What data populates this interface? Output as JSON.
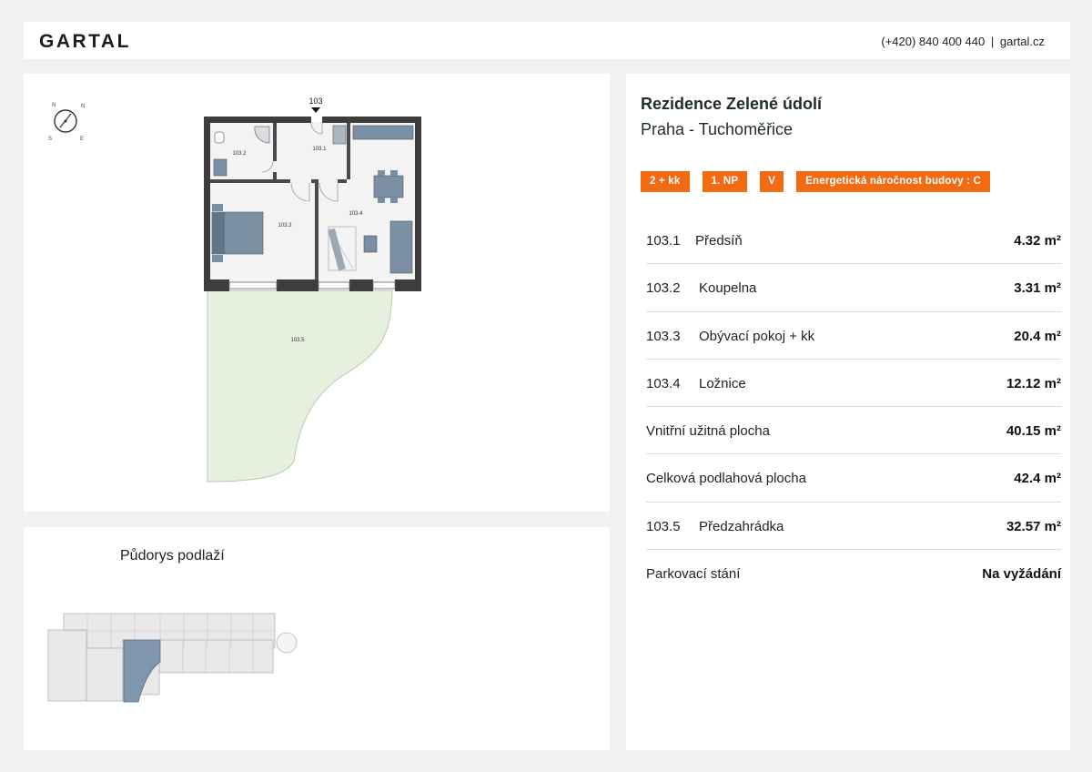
{
  "header": {
    "logo": "GARTAL",
    "phone": "(+420) 840 400 440",
    "separator": "|",
    "website": "gartal.cz"
  },
  "plan": {
    "unit_label": "103",
    "rooms": {
      "r1031": "103.1",
      "r1032": "103.2",
      "r1033": "103.3",
      "r1034": "103.4",
      "r1035": "103.5"
    },
    "compass_icon": "compass-icon"
  },
  "floor": {
    "title": "Půdorys podlaží"
  },
  "info": {
    "project_name": "Rezidence Zelené údolí",
    "location": "Praha - Tuchoměřice",
    "badges": [
      "2 + kk",
      "1. NP",
      "V",
      "Energetická náročnost budovy : C"
    ],
    "rows": [
      {
        "code": "103.1",
        "label": "Předsíň",
        "value": "4.32 m²"
      },
      {
        "code": "103.2",
        "label": "Koupelna",
        "value": "3.31 m²"
      },
      {
        "code": "103.3",
        "label": "Obývací pokoj + kk",
        "value": "20.4 m²"
      },
      {
        "code": "103.4",
        "label": "Ložnice",
        "value": "12.12 m²"
      },
      {
        "code": "",
        "label": "Vnitřní užitná plocha",
        "value": "40.15 m²"
      },
      {
        "code": "",
        "label": "Celková podlahová plocha",
        "value": "42.4 m²"
      },
      {
        "code": "103.5",
        "label": "Předzahrádka",
        "value": "32.57 m²"
      },
      {
        "code": "",
        "label": "Parkovací stání",
        "value": "Na vyžádání"
      }
    ]
  },
  "colors": {
    "accent": "#f26a12",
    "wall": "#3d3d3d",
    "garden": "#e6f0df",
    "highlight_unit": "#7f97ad"
  }
}
